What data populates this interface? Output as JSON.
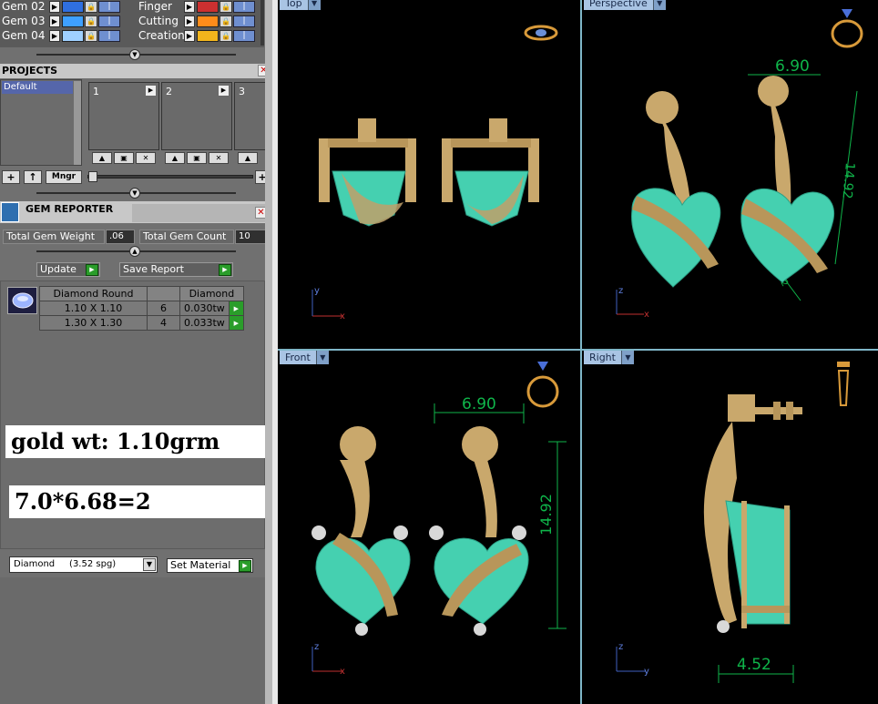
{
  "layers": [
    {
      "name": "Gem 02",
      "color": "#2f6fe0"
    },
    {
      "name": "Gem 03",
      "color": "#3ea0ff"
    },
    {
      "name": "Gem 04",
      "color": "#9fd0ff"
    }
  ],
  "layers_right": [
    {
      "name": "Finger",
      "color": "#cc3030"
    },
    {
      "name": "Cutting",
      "color": "#ff8c1a"
    },
    {
      "name": "Creation",
      "color": "#f2b51c"
    }
  ],
  "projects": {
    "header": "PROJECTS",
    "list": [
      "Default"
    ],
    "tiles": [
      "1",
      "2",
      "3"
    ],
    "manager_label": "Mngr"
  },
  "gem_reporter": {
    "header": "GEM REPORTER",
    "total_weight_label": "Total Gem Weight",
    "total_weight_value": ".06",
    "total_count_label": "Total Gem Count",
    "total_count_value": "10",
    "update_label": "Update",
    "save_label": "Save Report",
    "columns": [
      "Diamond Round",
      "",
      "Diamond"
    ],
    "rows": [
      {
        "size": "1.10 X 1.10",
        "count": "6",
        "weight": "0.030tw"
      },
      {
        "size": "1.30 X 1.30",
        "count": "4",
        "weight": "0.033tw"
      }
    ]
  },
  "notes": {
    "gold_wt": "gold wt: 1.10grm",
    "calc": "7.0*6.68=2"
  },
  "material": {
    "selected": "Diamond     (3.52 spg)",
    "set_label": "Set Material"
  },
  "viewports": {
    "top": "Top",
    "perspective": "Perspective",
    "front": "Front",
    "right": "Right"
  },
  "dimensions": {
    "width": "6.90",
    "height": "14.92",
    "depth": "4.52"
  },
  "axes": {
    "x": "x",
    "y": "y",
    "z": "z"
  },
  "colors": {
    "viewport_tab": "#a9c4e4",
    "dimension_green": "#0fb54a",
    "gold": "#c9a86c",
    "gem": "#45d0b0",
    "button_green": "#2a9d2a"
  }
}
